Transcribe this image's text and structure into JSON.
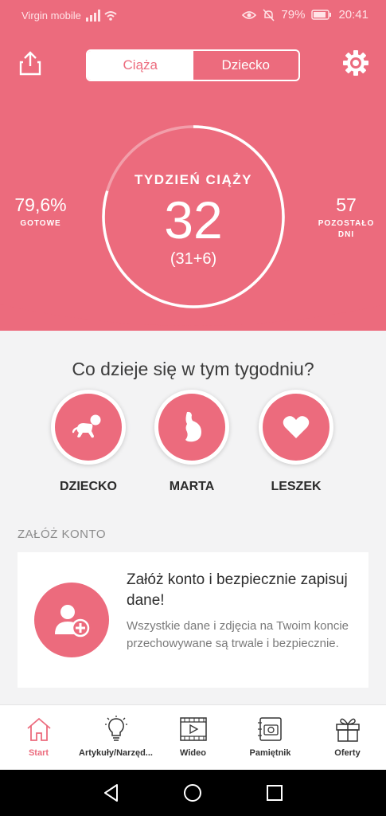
{
  "status_bar": {
    "carrier": "Virgin mobile",
    "battery": "79%",
    "time": "20:41"
  },
  "header": {
    "tabs": [
      {
        "label": "Ciąża",
        "active": true
      },
      {
        "label": "Dziecko",
        "active": false
      }
    ],
    "share_icon": "share-icon",
    "settings_icon": "gear-icon"
  },
  "progress": {
    "title": "TYDZIEŃ CIĄŻY",
    "week": "32",
    "sub": "(31+6)",
    "ready_value": "79,6%",
    "ready_label": "GOTOWE",
    "remaining_value": "57",
    "remaining_label_1": "POZOSTAŁO",
    "remaining_label_2": "DNI",
    "fraction": 0.796
  },
  "week_section": {
    "question": "Co dzieje się w tym tygodniu?",
    "items": [
      {
        "label": "DZIECKO",
        "icon": "baby-crawling-icon"
      },
      {
        "label": "MARTA",
        "icon": "pregnant-belly-icon"
      },
      {
        "label": "LESZEK",
        "icon": "heart-icon"
      }
    ]
  },
  "account": {
    "heading": "ZAŁÓŻ KONTO",
    "title": "Załóż konto i bezpiecznie zapisuj dane!",
    "text": "Wszystkie dane i zdjęcia na Twoim koncie przechowywane są trwale i bezpiecznie.",
    "icon": "add-user-icon"
  },
  "tabbar": [
    {
      "label": "Start",
      "icon": "home-icon",
      "active": true
    },
    {
      "label": "Artykuły/Narzęd...",
      "icon": "lightbulb-icon",
      "active": false
    },
    {
      "label": "Wideo",
      "icon": "video-icon",
      "active": false
    },
    {
      "label": "Pamiętnik",
      "icon": "camera-diary-icon",
      "active": false
    },
    {
      "label": "Oferty",
      "icon": "gift-icon",
      "active": false
    }
  ],
  "colors": {
    "brand": "#ec6b7d",
    "background": "#f3f3f4"
  }
}
